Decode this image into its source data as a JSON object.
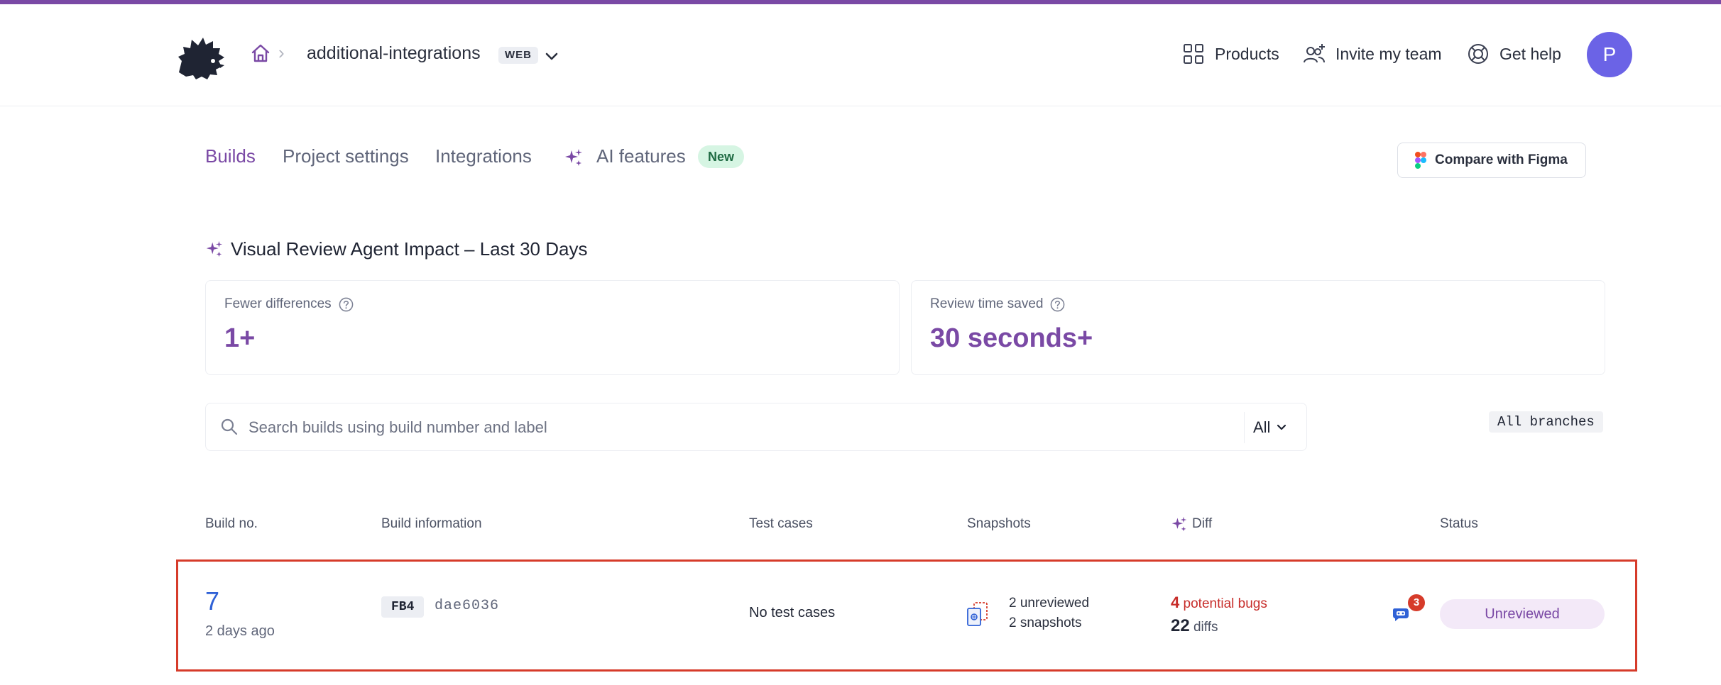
{
  "header": {
    "project_name": "additional-integrations",
    "project_tag": "WEB",
    "products_label": "Products",
    "invite_label": "Invite my team",
    "help_label": "Get help",
    "avatar_initial": "P"
  },
  "tabs": [
    {
      "label": "Builds",
      "active": true
    },
    {
      "label": "Project settings",
      "active": false
    },
    {
      "label": "Integrations",
      "active": false
    },
    {
      "label": "AI features",
      "active": false
    }
  ],
  "ai_badge": "New",
  "figma_button": "Compare with Figma",
  "impact": {
    "title": "Visual Review Agent Impact – Last 30 Days",
    "cards": [
      {
        "label": "Fewer differences",
        "value": "1+"
      },
      {
        "label": "Review time saved",
        "value": "30 seconds+"
      }
    ]
  },
  "search": {
    "placeholder": "Search builds using build number and label",
    "filter_value": "All",
    "branches": "All branches"
  },
  "table": {
    "columns": [
      "Build no.",
      "Build information",
      "Test cases",
      "Snapshots",
      "Diff",
      "Status"
    ],
    "rows": [
      {
        "build_no": "7",
        "ago": "2 days ago",
        "tag": "FB4",
        "commit": "dae6036",
        "test_cases": "No test cases",
        "unreviewed": "2 unreviewed",
        "snapshots": "2 snapshots",
        "bugs_count": "4",
        "bugs_label": " potential bugs",
        "diffs_count": "22",
        "diffs_label": " diffs",
        "agent_count": "3",
        "status": "Unreviewed"
      }
    ]
  },
  "colors": {
    "brand": "#7a49a5",
    "link": "#2f61d6",
    "danger": "#c72d2a",
    "highlight_border": "#d63b2a"
  },
  "icons": [
    "hedgehog-logo-icon",
    "home-icon",
    "chevron-right-icon",
    "chevron-down-icon",
    "grid-icon",
    "add-users-icon",
    "lifebuoy-icon",
    "sparkle-icon",
    "figma-icon",
    "help-circle-icon",
    "search-icon",
    "snapshot-icon",
    "agent-icon"
  ]
}
